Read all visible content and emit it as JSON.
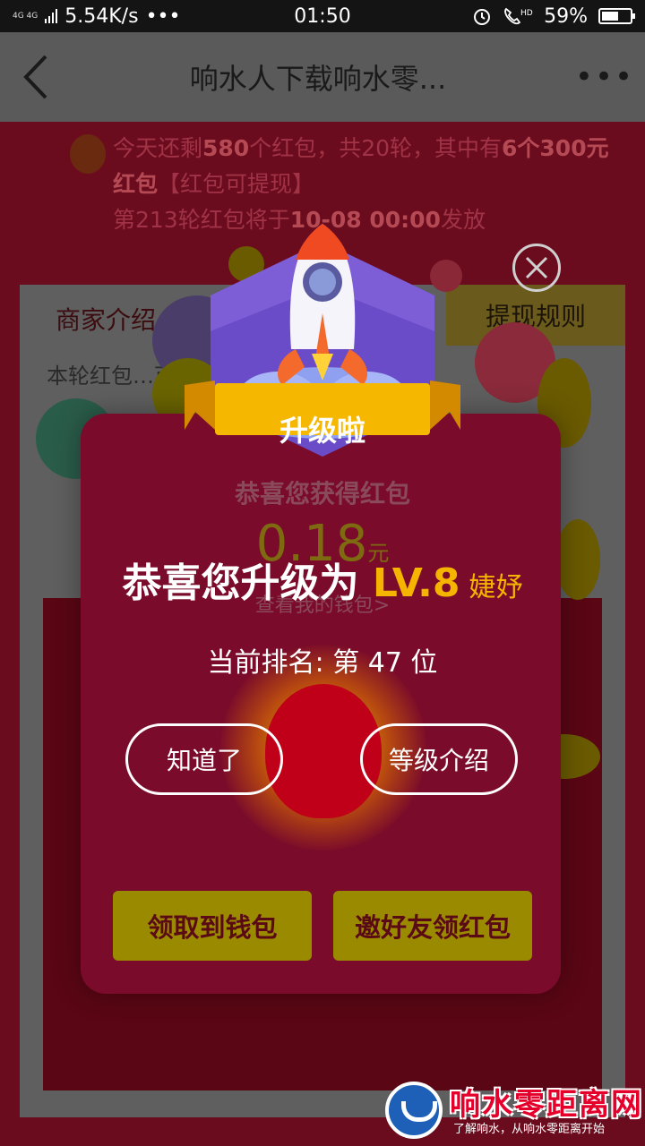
{
  "status_bar": {
    "network": "4G 4G",
    "speed": "5.54K/s",
    "dots": "•••",
    "time": "01:50",
    "hd": "HD",
    "battery": "59%",
    "battery_level": 0.59
  },
  "nav": {
    "back": "‹",
    "title": "响水人下载响水零...",
    "more": "•••"
  },
  "background_page": {
    "notice_parts": [
      "今天还剩",
      "580",
      "个红包，共20轮，其中有",
      "6个300元红包",
      "【红包可提现】"
    ],
    "notice_line2_parts": [
      "第213轮红包将于",
      "10-08 00:00",
      "发放"
    ],
    "tab_left": "商家介绍",
    "tab_right": "提现规则",
    "body_text": "本轮红包…可…人红…制！"
  },
  "popup": {
    "badge_label": "升级啦",
    "faded_title": "恭喜您获得红包",
    "faded_amount": "0.18",
    "faded_unit": "元",
    "faded_link": "查看我的钱包>",
    "congrats_prefix": "恭喜您升级为 ",
    "level": "LV.8",
    "rank_name": "婕妤",
    "current_rank": "当前排名: 第 47 位",
    "btn_ok": "知道了",
    "btn_levels": "等级介绍",
    "btn_wallet": "领取到钱包",
    "btn_invite": "邀好友领红包",
    "close": "×"
  },
  "watermark": {
    "name": "响水零距离网",
    "slogan": "了解响水，从响水零距离开始"
  },
  "colors": {
    "accent_gold": "#f5b400",
    "popup_bg": "#7a0b2a",
    "button_gold": "#9a8a00"
  }
}
